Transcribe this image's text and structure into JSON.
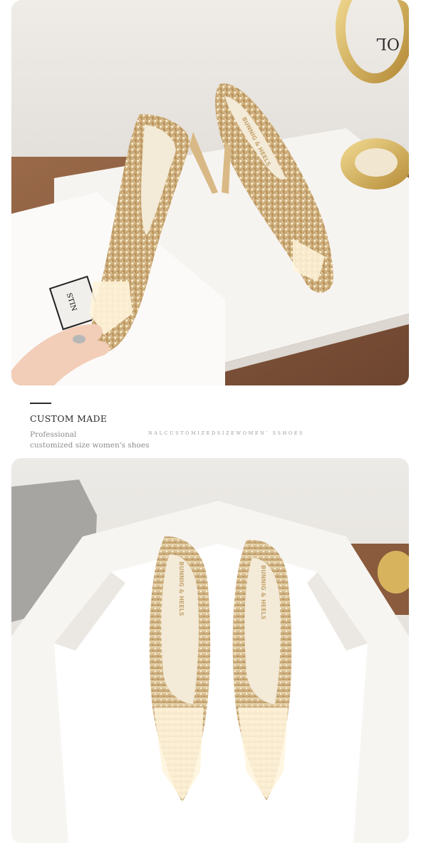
{
  "section": {
    "title": "CUSTOM MADE",
    "subtitle_line1": "Professional",
    "subtitle_line2": "customized size women's shoes",
    "caption": "NALCUSTOMIZEDSIZEWOMEN' SSHOES"
  },
  "photo_top": {
    "insole_label": "BUNNIG & HEELS",
    "bag_label": "STIN",
    "frame_label": "OL"
  },
  "photo_bottom": {
    "insole_label_left": "BUNNIG & HEELS",
    "insole_label_right": "BUNNIG & HEELS"
  },
  "colors": {
    "background": "#ffffff",
    "shoe_gold": "#d8c08f",
    "wood_floor": "#8a5b3d",
    "box_white": "#f6f4f1",
    "title_text": "#2a2a2a",
    "sub_text": "#8c8c8c"
  }
}
